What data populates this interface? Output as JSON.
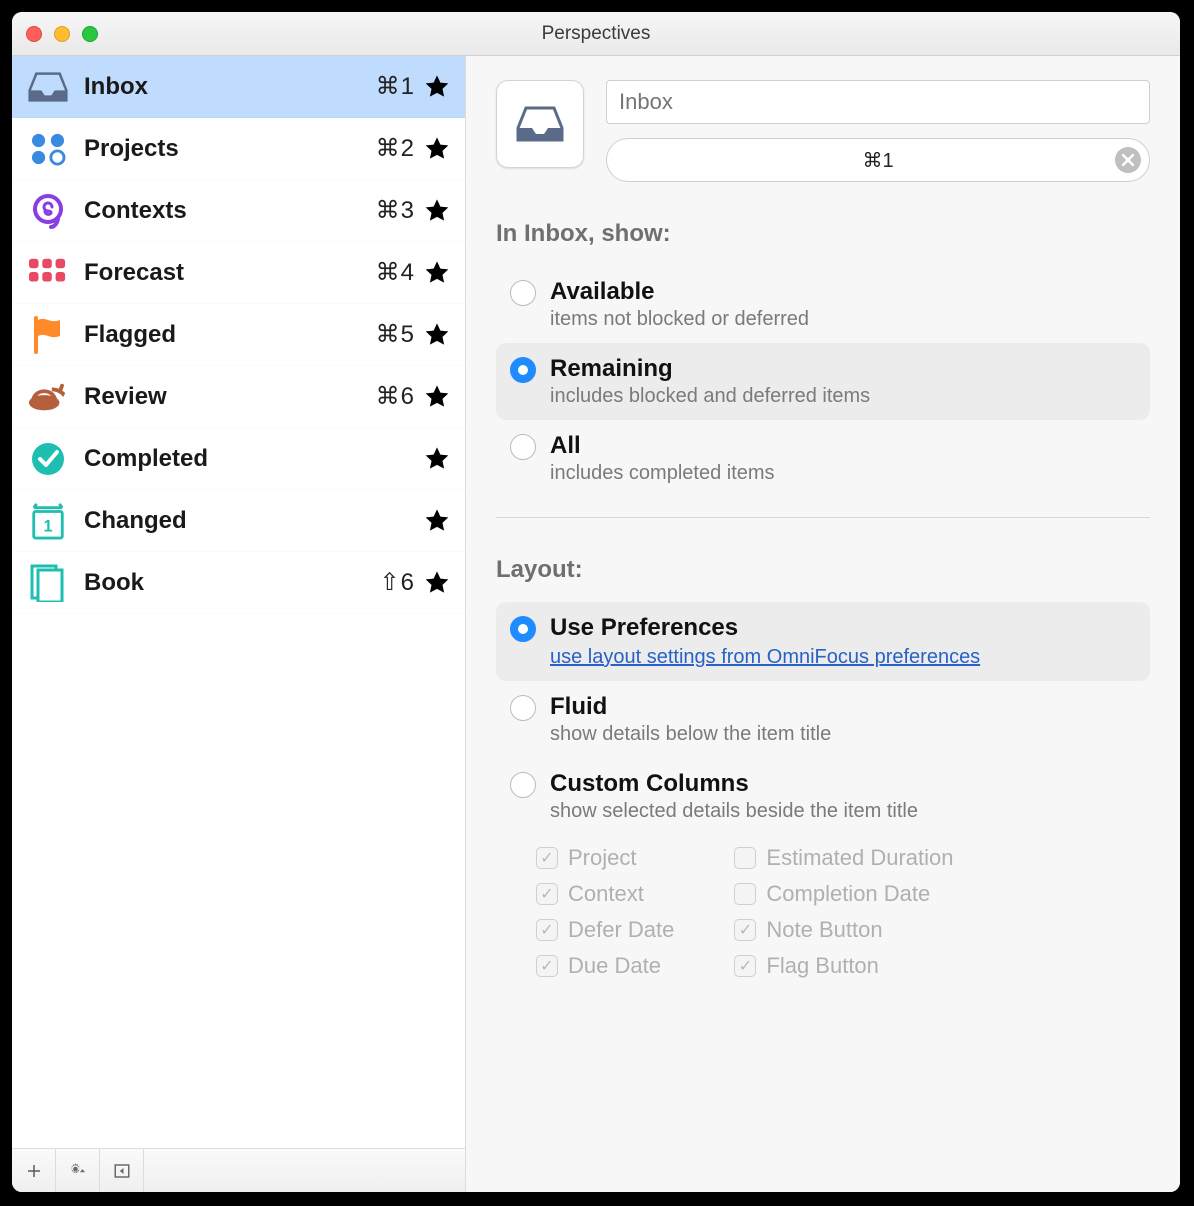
{
  "window": {
    "title": "Perspectives"
  },
  "sidebar": {
    "items": [
      {
        "label": "Inbox",
        "shortcut": "⌘1",
        "favorite": true,
        "selected": true,
        "icon": "inbox"
      },
      {
        "label": "Projects",
        "shortcut": "⌘2",
        "favorite": true,
        "selected": false,
        "icon": "projects"
      },
      {
        "label": "Contexts",
        "shortcut": "⌘3",
        "favorite": true,
        "selected": false,
        "icon": "contexts"
      },
      {
        "label": "Forecast",
        "shortcut": "⌘4",
        "favorite": true,
        "selected": false,
        "icon": "forecast"
      },
      {
        "label": "Flagged",
        "shortcut": "⌘5",
        "favorite": true,
        "selected": false,
        "icon": "flagged"
      },
      {
        "label": "Review",
        "shortcut": "⌘6",
        "favorite": true,
        "selected": false,
        "icon": "review"
      },
      {
        "label": "Completed",
        "shortcut": "",
        "favorite": false,
        "selected": false,
        "icon": "completed"
      },
      {
        "label": "Changed",
        "shortcut": "",
        "favorite": false,
        "selected": false,
        "icon": "changed"
      },
      {
        "label": "Book",
        "shortcut": "⇧6",
        "favorite": true,
        "selected": false,
        "icon": "book"
      }
    ]
  },
  "detail": {
    "name_placeholder": "Inbox",
    "shortcut_value": "⌘1",
    "show": {
      "title": "In Inbox, show:",
      "options": [
        {
          "title": "Available",
          "desc": "items not blocked or deferred",
          "selected": false
        },
        {
          "title": "Remaining",
          "desc": "includes blocked and deferred items",
          "selected": true
        },
        {
          "title": "All",
          "desc": "includes completed items",
          "selected": false
        }
      ]
    },
    "layout": {
      "title": "Layout:",
      "options": [
        {
          "title": "Use Preferences",
          "link": "use layout settings from OmniFocus preferences",
          "selected": true
        },
        {
          "title": "Fluid",
          "desc": "show details below the item title",
          "selected": false
        },
        {
          "title": "Custom Columns",
          "desc": "show selected details beside the item title",
          "selected": false
        }
      ],
      "columns_left": [
        {
          "label": "Project",
          "checked": true
        },
        {
          "label": "Context",
          "checked": true
        },
        {
          "label": "Defer Date",
          "checked": true
        },
        {
          "label": "Due Date",
          "checked": true
        }
      ],
      "columns_right": [
        {
          "label": "Estimated Duration",
          "checked": false
        },
        {
          "label": "Completion Date",
          "checked": false
        },
        {
          "label": "Note Button",
          "checked": true
        },
        {
          "label": "Flag Button",
          "checked": true
        }
      ]
    }
  }
}
